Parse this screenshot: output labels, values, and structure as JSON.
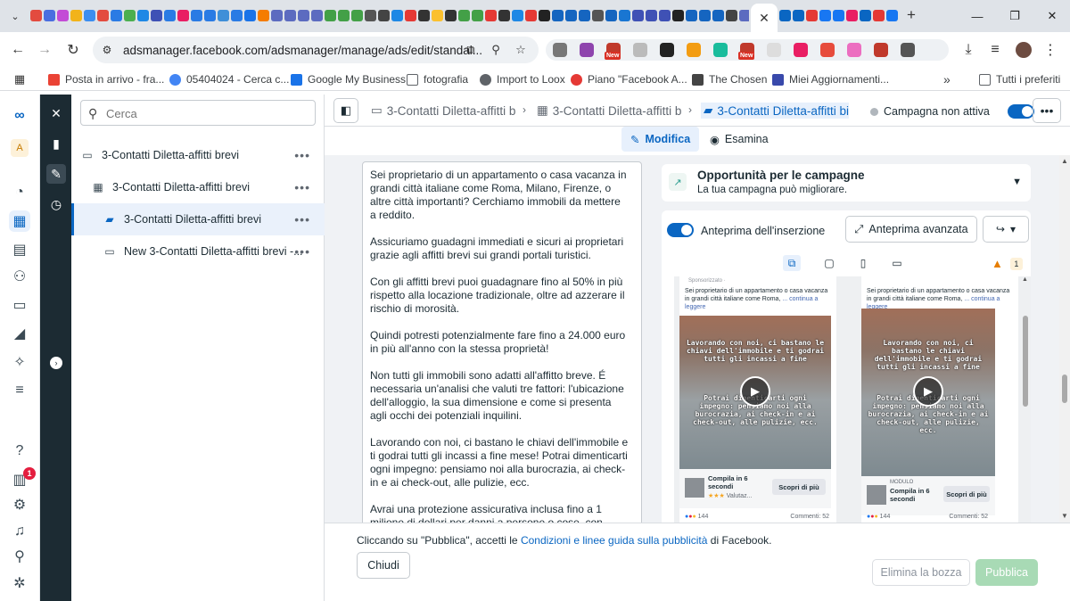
{
  "browser": {
    "active_tab_close": "✕",
    "url": "adsmanager.facebook.com/adsmanager/manage/ads/edit/standal...",
    "bookmarks": [
      {
        "label": "Posta in arrivo - fra..."
      },
      {
        "label": "05404024 - Cerca c..."
      },
      {
        "label": "Google My Business"
      },
      {
        "label": "fotografia"
      },
      {
        "label": "Import to Loox"
      },
      {
        "label": "Piano \"Facebook A..."
      },
      {
        "label": "The Chosen"
      },
      {
        "label": "Miei Aggiornamenti..."
      }
    ],
    "bookmarks_more": "»",
    "all_bookmarks": "Tutti i preferiti",
    "new_badge": "New"
  },
  "tree": {
    "search_placeholder": "Cerca",
    "items": [
      {
        "label": "3-Contatti Diletta-affitti brevi"
      },
      {
        "label": "3-Contatti Diletta-affitti brevi"
      },
      {
        "label": "3-Contatti Diletta-affitti brevi"
      },
      {
        "label": "New 3-Contatti Diletta-affitti brevi -..."
      }
    ],
    "more": "•••"
  },
  "header": {
    "breadcrumbs": [
      {
        "label": "3-Contatti Diletta-affitti b"
      },
      {
        "label": "3-Contatti Diletta-affitti b"
      },
      {
        "label": "3-Contatti Diletta-affitti bi"
      }
    ],
    "status": "Campagna non attiva",
    "more": "•••",
    "mode_edit": "Modifica",
    "mode_review": "Esamina"
  },
  "ad_text": {
    "paragraphs": [
      "Sei proprietario di un appartamento o casa vacanza in grandi città italiane come Roma, Milano, Firenze, o altre città importanti? Cerchiamo immobili da mettere a reddito.",
      "Assicuriamo guadagni immediati e sicuri ai proprietari grazie agli affitti brevi sui grandi portali turistici.",
      "Con gli affitti brevi puoi guadagnare fino al 50% in più rispetto alla locazione tradizionale, oltre ad azzerare il rischio di morosità.",
      "Quindi potresti potenzialmente fare fino a 24.000 euro in più all'anno con la stessa proprietà!",
      "Non tutti gli immobili sono adatti all'affitto breve. É necessaria un'analisi che valuti tre fattori: l'ubicazione dell'alloggio, la sua dimensione e come si presenta agli occhi dei potenziali inquilini.",
      "Lavorando con noi, ci bastano le chiavi dell'immobile e ti godrai tutti gli incassi a fine mese! Potrai dimenticarti ogni impegno: pensiamo noi alla burocrazia, ai check-in e ai check-out, alle pulizie, ecc.",
      "Avrai una protezione assicurativa inclusa fino a 1 milione di dollari per danni a persone o cose, con"
    ]
  },
  "opportunity": {
    "title": "Opportunità per le campagne",
    "subtitle": "La tua campagna può migliorare."
  },
  "preview": {
    "label": "Anteprima dell'inserzione",
    "advanced": "Anteprima avanzata",
    "warning_count": "1",
    "cards": [
      {
        "sponsored": "Sponsorizzato · ",
        "text": "Sei proprietario di un appartamento o casa vacanza in grandi città italiane come Roma,",
        "more": "... continua a leggere",
        "overlay_top": "Lavorando con noi, ci bastano le chiavi dell'immobile e ti godrai tutti gli incassi a fine",
        "overlay_bottom": "Potrai dimenticarti ogni impegno: pensiamo noi alla burocrazia, ai check-in e ai check-out, alle pulizie, ecc.",
        "cta_small": "",
        "cta_title": "Compila in 6 secondi",
        "stars": "★★★",
        "rating_label": "Valutaz...",
        "cta_button": "Scopri di più",
        "reactions": "144",
        "comments": "Commenti: 52"
      },
      {
        "sponsored": "",
        "text": "Sei proprietario di un appartamento o casa vacanza in grandi città italiane come Roma,",
        "more": "... continua a leggere",
        "overlay_top": "Lavorando con noi, ci bastano le chiavi dell'immobile e ti godrai tutti gli incassi a fine",
        "overlay_bottom": "Potrai dimenticarti ogni impegno: pensiamo noi alla burocrazia, ai check-in e ai check-out, alle pulizie, ecc.",
        "cta_small": "MODULO",
        "cta_title": "Compila in 6 secondi",
        "stars": "",
        "rating_label": "",
        "cta_button": "Scopri di più",
        "reactions": "144",
        "comments": "Commenti: 52"
      }
    ]
  },
  "footer": {
    "legal_prefix": "Cliccando su \"Pubblica\", accetti le ",
    "legal_link": "Condizioni e linee guida sulla pubblicità",
    "legal_suffix": " di Facebook.",
    "close": "Chiudi",
    "delete_draft": "Elimina la bozza",
    "publish": "Pubblica"
  },
  "colors": {
    "accent": "#0a66c2",
    "dark_sidebar": "#1c2b33",
    "publish_disabled": "#a8dab5",
    "notification_badge": "#e41e3f"
  },
  "rail_badge": "1"
}
